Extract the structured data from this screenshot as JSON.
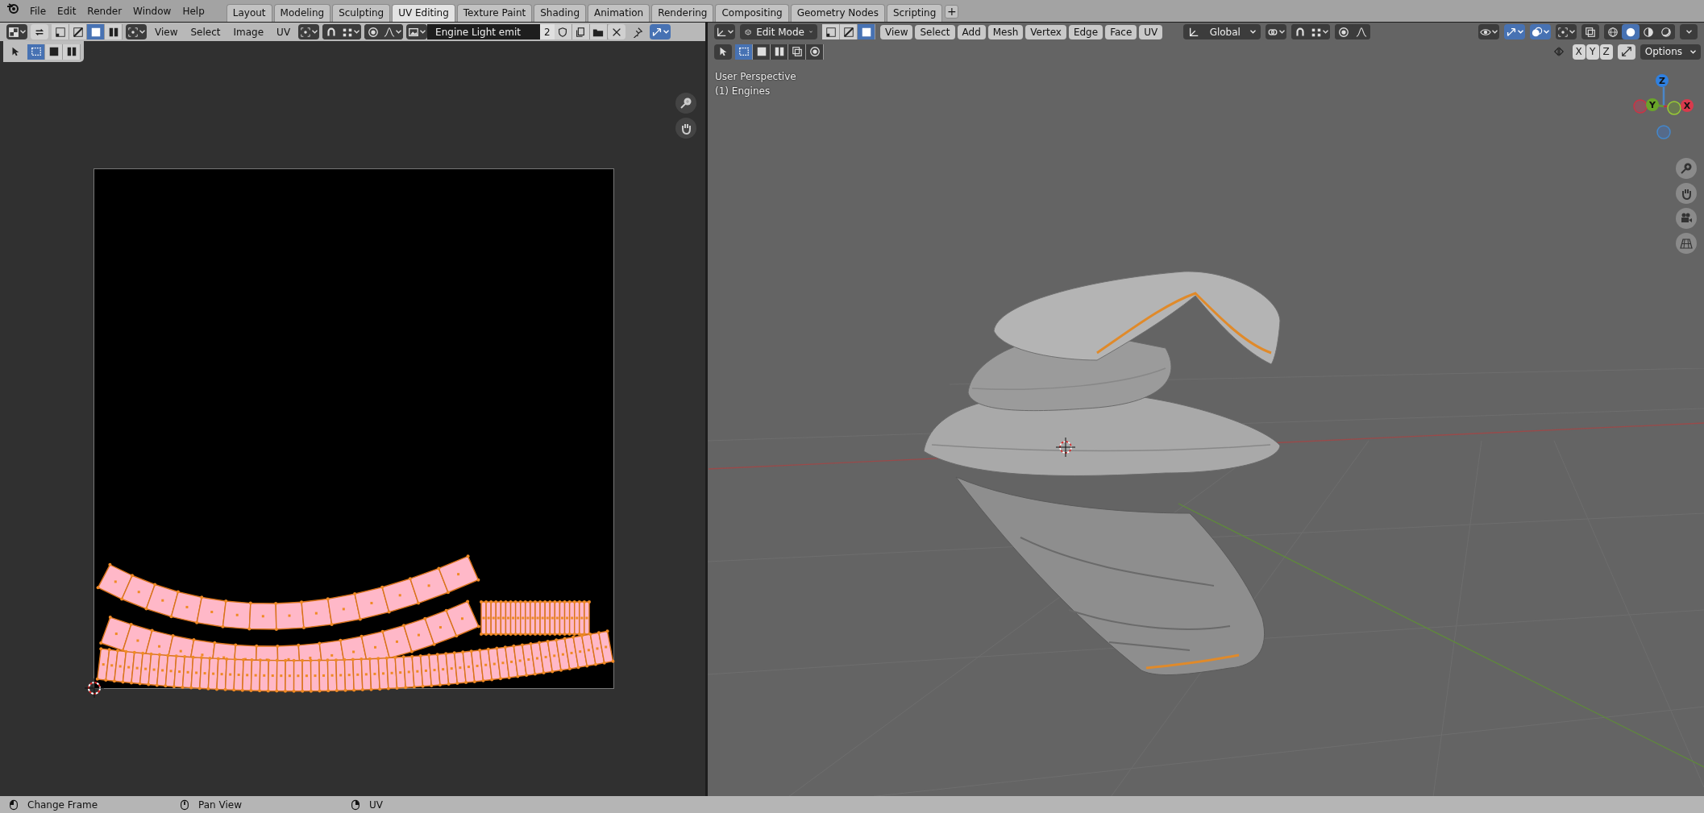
{
  "top_menu": [
    "File",
    "Edit",
    "Render",
    "Window",
    "Help"
  ],
  "workspace_tabs": [
    {
      "label": "Layout",
      "selected": false
    },
    {
      "label": "Modeling",
      "selected": false
    },
    {
      "label": "Sculpting",
      "selected": false
    },
    {
      "label": "UV Editing",
      "selected": true
    },
    {
      "label": "Texture Paint",
      "selected": false
    },
    {
      "label": "Shading",
      "selected": false
    },
    {
      "label": "Animation",
      "selected": false
    },
    {
      "label": "Rendering",
      "selected": false
    },
    {
      "label": "Compositing",
      "selected": false
    },
    {
      "label": "Geometry Nodes",
      "selected": false
    },
    {
      "label": "Scripting",
      "selected": false
    }
  ],
  "add_tab": "+",
  "uv_editor": {
    "select_modes": [
      {
        "selected": false
      },
      {
        "selected": false
      },
      {
        "selected": true
      },
      {
        "selected": false
      }
    ],
    "menus": [
      "View",
      "Select",
      "Image",
      "UV"
    ],
    "image_name": "Engine Light emit",
    "image_users": "2",
    "tool_modes": [
      {
        "selected": true
      },
      {
        "selected": false
      },
      {
        "selected": false
      }
    ]
  },
  "viewport": {
    "mode": "Edit Mode",
    "select_modes": [
      {
        "selected": false
      },
      {
        "selected": false
      },
      {
        "selected": true
      }
    ],
    "menus": [
      "View",
      "Select",
      "Add",
      "Mesh",
      "Vertex",
      "Edge",
      "Face",
      "UV"
    ],
    "orientation": "Global",
    "gizmos_on": true,
    "overlays_on": true,
    "shading_modes": [
      {
        "selected": false
      },
      {
        "selected": true
      },
      {
        "selected": false
      },
      {
        "selected": false
      }
    ],
    "tool_modes": [
      {
        "selected": true
      },
      {
        "selected": false
      },
      {
        "selected": false
      },
      {
        "selected": false
      },
      {
        "selected": false
      }
    ],
    "overlay_lines": [
      "User Perspective",
      "(1) Engines"
    ],
    "axis_labels": [
      "Z",
      "Y",
      "X"
    ],
    "mirror_axes": [
      "X",
      "Y",
      "Z"
    ],
    "options": "Options"
  },
  "status_bar": [
    "Change Frame",
    "Pan View",
    "UV"
  ]
}
